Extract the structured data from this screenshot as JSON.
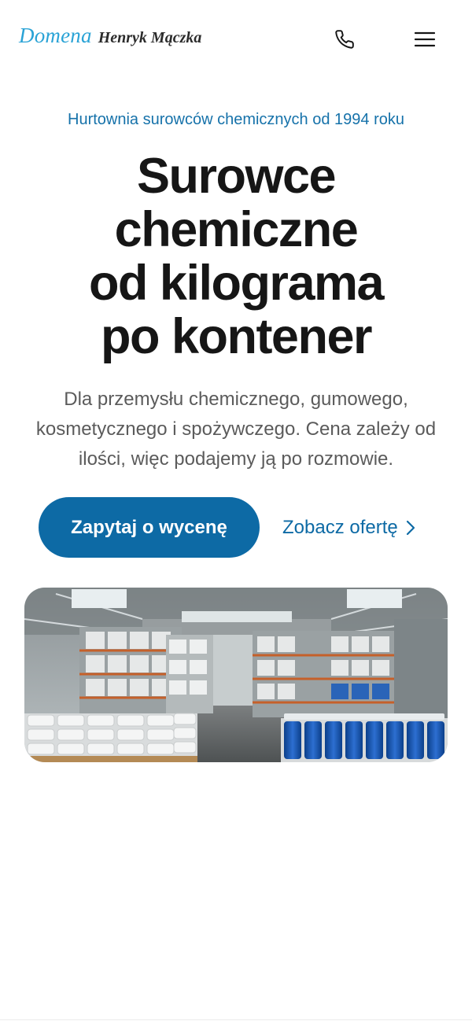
{
  "header": {
    "logo_brand": "Domena",
    "logo_owner": "Henryk Mączka",
    "phone_icon": "phone-icon",
    "menu_icon": "menu-icon"
  },
  "hero": {
    "eyebrow": "Hurtownia surowców chemicznych od 1994 roku",
    "headline_lines": [
      "Surowce",
      "chemiczne",
      "od kilograma",
      "po kontener"
    ],
    "lead_lines": [
      "Dla przemysłu chemicznego, gumowego,",
      "kosmetycznego i spożywczego. Cena zależy od",
      "ilości, więc podajemy ją po rozmowie."
    ],
    "primary_cta": "Zapytaj o wycenę",
    "secondary_cta": "Zobacz ofertę",
    "secondary_cta_icon": "chevron-right-icon"
  },
  "colors": {
    "accent": "#0d6aa5",
    "logo_blue": "#2aa3d6",
    "headline": "#161616",
    "body_text": "#5b5b5b"
  }
}
